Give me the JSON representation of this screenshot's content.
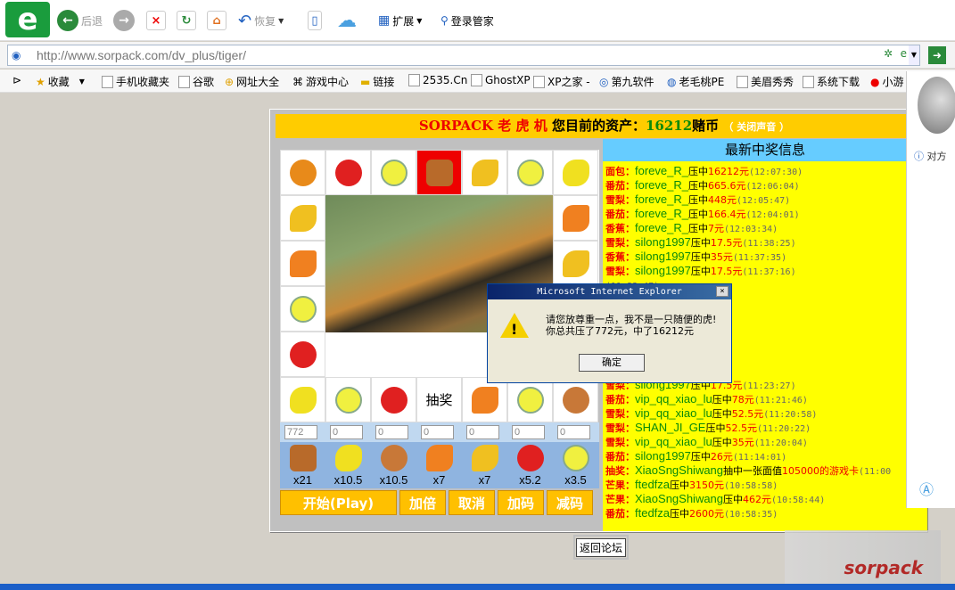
{
  "toolbar": {
    "back": "后退",
    "restore": "恢复",
    "extend": "扩展",
    "login": "登录管家"
  },
  "address": {
    "url": "http://www.sorpack.com/dv_plus/tiger/"
  },
  "favorites": [
    "收藏",
    "手机收藏夹",
    "谷歌",
    "网址大全",
    "游戏中心",
    "链接",
    "2535.Cn",
    "GhostXP",
    "XP之家 -",
    "第九软件",
    "老毛桃PE",
    "美眉秀秀",
    "系统下载",
    "小游"
  ],
  "game": {
    "title_brand": "SORPACK 老 虎 机",
    "title_assets": "您目前的资产：",
    "balance": "16212",
    "currency": "赌币",
    "mute": "（ 关闭声音 ）",
    "lottery": "抽奖",
    "inputs": [
      "772",
      "0",
      "0",
      "0",
      "0",
      "0",
      "0"
    ],
    "multipliers": [
      "x21",
      "x10.5",
      "x10.5",
      "x7",
      "x7",
      "x5.2",
      "x3.5"
    ],
    "buttons": {
      "start": "开始(Play)",
      "double": "加倍",
      "cancel": "取消",
      "add": "加码",
      "reduce": "减码"
    },
    "back_forum": "返回论坛"
  },
  "colors": {
    "orange": "#e88a1a",
    "tomato": "#e02020",
    "apple": "#f0f040",
    "bread": "#b86a2a",
    "banana": "#f0c020",
    "lemon": "#f0e020",
    "peach": "#c87838"
  },
  "winners": {
    "title": "最新中奖信息",
    "rows": [
      {
        "item": "面包：",
        "user": "foreve_R_",
        "mid": "压中",
        "amt": "16212元",
        "time": "(12:07:30)"
      },
      {
        "item": "番茄：",
        "user": "foreve_R_",
        "mid": "压中",
        "amt": "665.6元",
        "time": "(12:06:04)"
      },
      {
        "item": "雪梨：",
        "user": "foreve_R_",
        "mid": "压中",
        "amt": "448元",
        "time": "(12:05:47)"
      },
      {
        "item": "番茄：",
        "user": "foreve_R_",
        "mid": "压中",
        "amt": "166.4元",
        "time": "(12:04:01)"
      },
      {
        "item": "香蕉：",
        "user": "foreve_R_",
        "mid": "压中",
        "amt": "7元",
        "time": "(12:03:34)"
      },
      {
        "item": "雪梨：",
        "user": "silong1997",
        "mid": "压中",
        "amt": "17.5元",
        "time": "(11:38:25)"
      },
      {
        "item": "香蕉：",
        "user": "silong1997",
        "mid": "压中",
        "amt": "35元",
        "time": "(11:37:35)"
      },
      {
        "item": "雪梨：",
        "user": "silong1997",
        "mid": "压中",
        "amt": "17.5元",
        "time": "(11:37:16)"
      },
      {
        "item": "",
        "user": "",
        "mid": "",
        "amt": "",
        "time": "(11:33:47)"
      },
      {
        "item": "",
        "user": "",
        "mid": "",
        "amt": "",
        "time": "(11:33:26)"
      },
      {
        "item": "",
        "user": "",
        "mid": "",
        "amt": "",
        "time": "(11:32:40)"
      },
      {
        "item": "",
        "user": "",
        "mid": "",
        "amt": ".5",
        "time": "(11:25:44)"
      },
      {
        "item": "",
        "user": "",
        "mid": "",
        "amt": ".5",
        "time": "(11:24:44)"
      },
      {
        "item": "",
        "user": "",
        "mid": "",
        "amt": ".5",
        "time": "(11:24:08)"
      },
      {
        "item": "",
        "user": "",
        "mid": "",
        "amt": ".5",
        "time": "(11:23:50)"
      },
      {
        "item": "雪梨：",
        "user": "silong1997",
        "mid": "压中",
        "amt": "17.5元",
        "time": "(11:23:27)"
      },
      {
        "item": "番茄：",
        "user": "vip_qq_xiao_lu",
        "mid": "压中",
        "amt": "78元",
        "time": "(11:21:46)"
      },
      {
        "item": "雪梨：",
        "user": "vip_qq_xiao_lu",
        "mid": "压中",
        "amt": "52.5元",
        "time": "(11:20:58)"
      },
      {
        "item": "雪梨：",
        "user": "SHAN_JI_GE",
        "mid": "压中",
        "amt": "52.5元",
        "time": "(11:20:22)"
      },
      {
        "item": "雪梨：",
        "user": "vip_qq_xiao_lu",
        "mid": "压中",
        "amt": "35元",
        "time": "(11:20:04)"
      },
      {
        "item": "番茄：",
        "user": "silong1997",
        "mid": "压中",
        "amt": "26元",
        "time": "(11:14:01)"
      },
      {
        "item": "抽奖：",
        "user": "XiaoSngShiwang",
        "mid": "抽中一张面值",
        "amt": "105000的游戏卡",
        "time": "(11:00"
      },
      {
        "item": "芒果：",
        "user": "ftedfza",
        "mid": "压中",
        "amt": "3150元",
        "time": "(10:58:58)"
      },
      {
        "item": "芒果：",
        "user": "XiaoSngShiwang",
        "mid": "压中",
        "amt": "462元",
        "time": "(10:58:44)"
      },
      {
        "item": "番茄：",
        "user": "ftedfza",
        "mid": "压中",
        "amt": "2600元",
        "time": "(10:58:35)"
      }
    ]
  },
  "dialog": {
    "title": "Microsoft Internet Explorer",
    "line1": "请您放尊重一点，我不是一只随便的虎!",
    "line2": "你总共压了772元，中了16212元",
    "ok": "确定",
    "close": "×"
  },
  "side": {
    "text": "对方"
  },
  "watermark": "sorpack"
}
